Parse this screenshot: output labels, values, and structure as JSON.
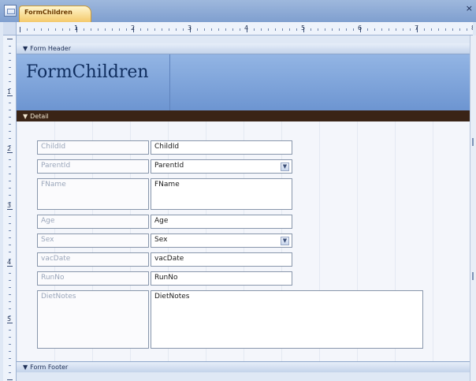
{
  "tab": {
    "title": "FormChildren",
    "close": "×"
  },
  "ruler": {
    "h_numbers": [
      "1",
      "2",
      "3",
      "4",
      "5",
      "6",
      "7",
      "8"
    ],
    "v_numbers": [
      "1",
      "2",
      "3",
      "4",
      "5"
    ]
  },
  "sections": {
    "header": "Form Header",
    "detail": "Detail",
    "footer": "Form Footer",
    "arrow": "▼"
  },
  "form_title": "FormChildren",
  "fields": [
    {
      "label": "ChildId",
      "control": "ChildId",
      "combo": false
    },
    {
      "label": "ParentId",
      "control": "ParentId",
      "combo": true
    },
    {
      "label": "FName",
      "control": "FName",
      "combo": false
    },
    {
      "label": "Age",
      "control": "Age",
      "combo": false
    },
    {
      "label": "Sex",
      "control": "Sex",
      "combo": true
    },
    {
      "label": "vacDate",
      "control": "vacDate",
      "combo": false
    },
    {
      "label": "RunNo",
      "control": "RunNo",
      "combo": false
    },
    {
      "label": "DietNotes",
      "control": "DietNotes",
      "combo": false
    }
  ],
  "combo_arrow": "▼",
  "colors": {
    "header": "#7da3db",
    "detail_bar": "#3a2416",
    "tab": "#f4c96b"
  },
  "icons": {
    "app": "form-document-icon"
  }
}
